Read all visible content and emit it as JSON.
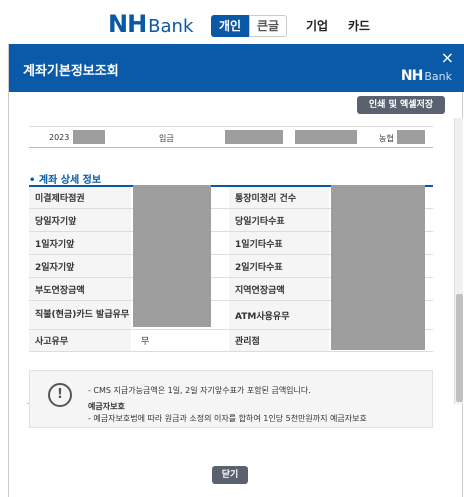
{
  "header": {
    "logo_nh": "NH",
    "logo_bank": "Bank",
    "tabs": [
      "개인",
      "큰글",
      "기업",
      "카드"
    ]
  },
  "modal": {
    "title": "계좌기본정보조회",
    "close_icon": "×",
    "logo_nh": "NH",
    "logo_bank": "Bank",
    "print_button": "인쇄 및 엑셀저장"
  },
  "prev_row": {
    "date": "2023",
    "type": "입금",
    "bank": "농협"
  },
  "section": {
    "title": "• 계좌 상세 정보"
  },
  "details": {
    "rows": [
      {
        "left_label": "미결제타점권",
        "left_value": "",
        "right_label": "통장미정리 건수",
        "right_value": ""
      },
      {
        "left_label": "당일자기앞",
        "left_value": "",
        "right_label": "당일기타수표",
        "right_value": ""
      },
      {
        "left_label": "1일자기앞",
        "left_value": "",
        "right_label": "1일기타수표",
        "right_value": ""
      },
      {
        "left_label": "2일자기앞",
        "left_value": "",
        "right_label": "2일기타수표",
        "right_value": ""
      },
      {
        "left_label": "부도연장금액",
        "left_value": "",
        "right_label": "지역연장금액",
        "right_value": ""
      },
      {
        "left_label": "직불(현금)카드 발급유무",
        "left_value": "",
        "right_label": "ATM사용유무",
        "right_value": ""
      },
      {
        "left_label": "사고유무",
        "left_value": "무",
        "right_label": "관리점",
        "right_value": ""
      }
    ]
  },
  "notice": {
    "icon": "!",
    "line1": "- CMS 지급가능금액은 1일, 2일 자기앞수표가 포함된 금액입니다.",
    "heading": "예금자보호",
    "line2": "- 예금자보호법에 따라 원금과 소정의 이자를 합하여 1인당 5천만원까지 예금자보호"
  },
  "footer": {
    "close_button": "닫기"
  },
  "colors": {
    "brand_blue": "#0b5aa9",
    "button_gray": "#5a6270",
    "highlight_green": "#7cc44a",
    "redaction_gray": "#9e9e9e"
  }
}
